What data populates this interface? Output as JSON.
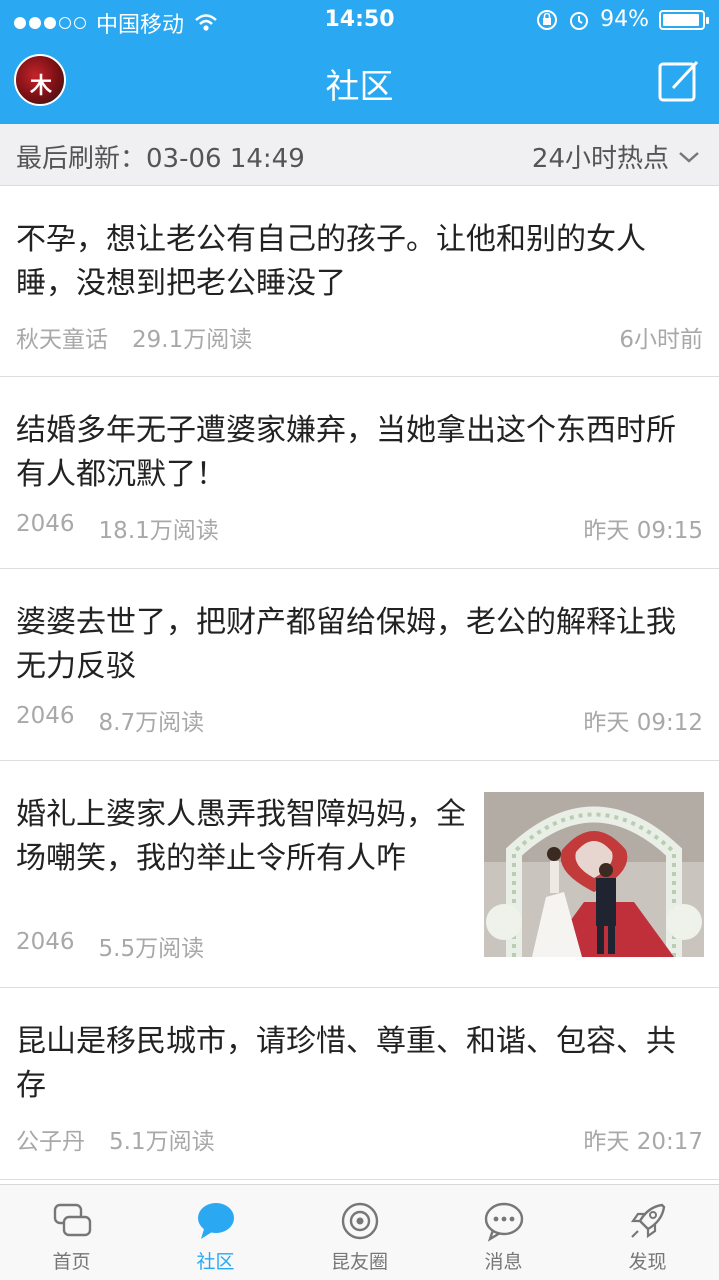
{
  "status_bar": {
    "carrier": "中国移动",
    "time": "14:50",
    "battery": "94%",
    "battery_level": 0.94
  },
  "header": {
    "title": "社区",
    "avatar_text": "木"
  },
  "refresh_bar": {
    "last_refresh": "最后刷新：03-06  14:49",
    "filter_label": "24小时热点"
  },
  "posts": [
    {
      "title": "不孕，想让老公有自己的孩子。让他和别的女人睡，没想到把老公睡没了",
      "author": "秋天童话",
      "reads": "29.1万阅读",
      "time": "6小时前"
    },
    {
      "title": "结婚多年无子遭婆家嫌弃，当她拿出这个东西时所有人都沉默了！",
      "author": "2046",
      "reads": "18.1万阅读",
      "time": "昨天 09:15"
    },
    {
      "title": "婆婆去世了，把财产都留给保姆，老公的解释让我无力反驳",
      "author": "2046",
      "reads": "8.7万阅读",
      "time": "昨天 09:12"
    },
    {
      "title": "婚礼上婆家人愚弄我智障妈妈，全场嘲笑，我的举止令所有人咋",
      "author": "2046",
      "reads": "5.5万阅读",
      "time": ""
    },
    {
      "title": "昆山是移民城市，请珍惜、尊重、和谐、包容、共存",
      "author": "公子丹",
      "reads": "5.1万阅读",
      "time": "昨天 20:17"
    }
  ],
  "tabs": [
    {
      "label": "首页",
      "icon": "home-chat-icon"
    },
    {
      "label": "社区",
      "icon": "community-bubble-icon"
    },
    {
      "label": "昆友圈",
      "icon": "moments-eye-icon"
    },
    {
      "label": "消息",
      "icon": "message-bubble-icon"
    },
    {
      "label": "发现",
      "icon": "rocket-icon"
    }
  ],
  "colors": {
    "accent": "#2aa8f2",
    "muted_text": "#a8a8a8"
  }
}
